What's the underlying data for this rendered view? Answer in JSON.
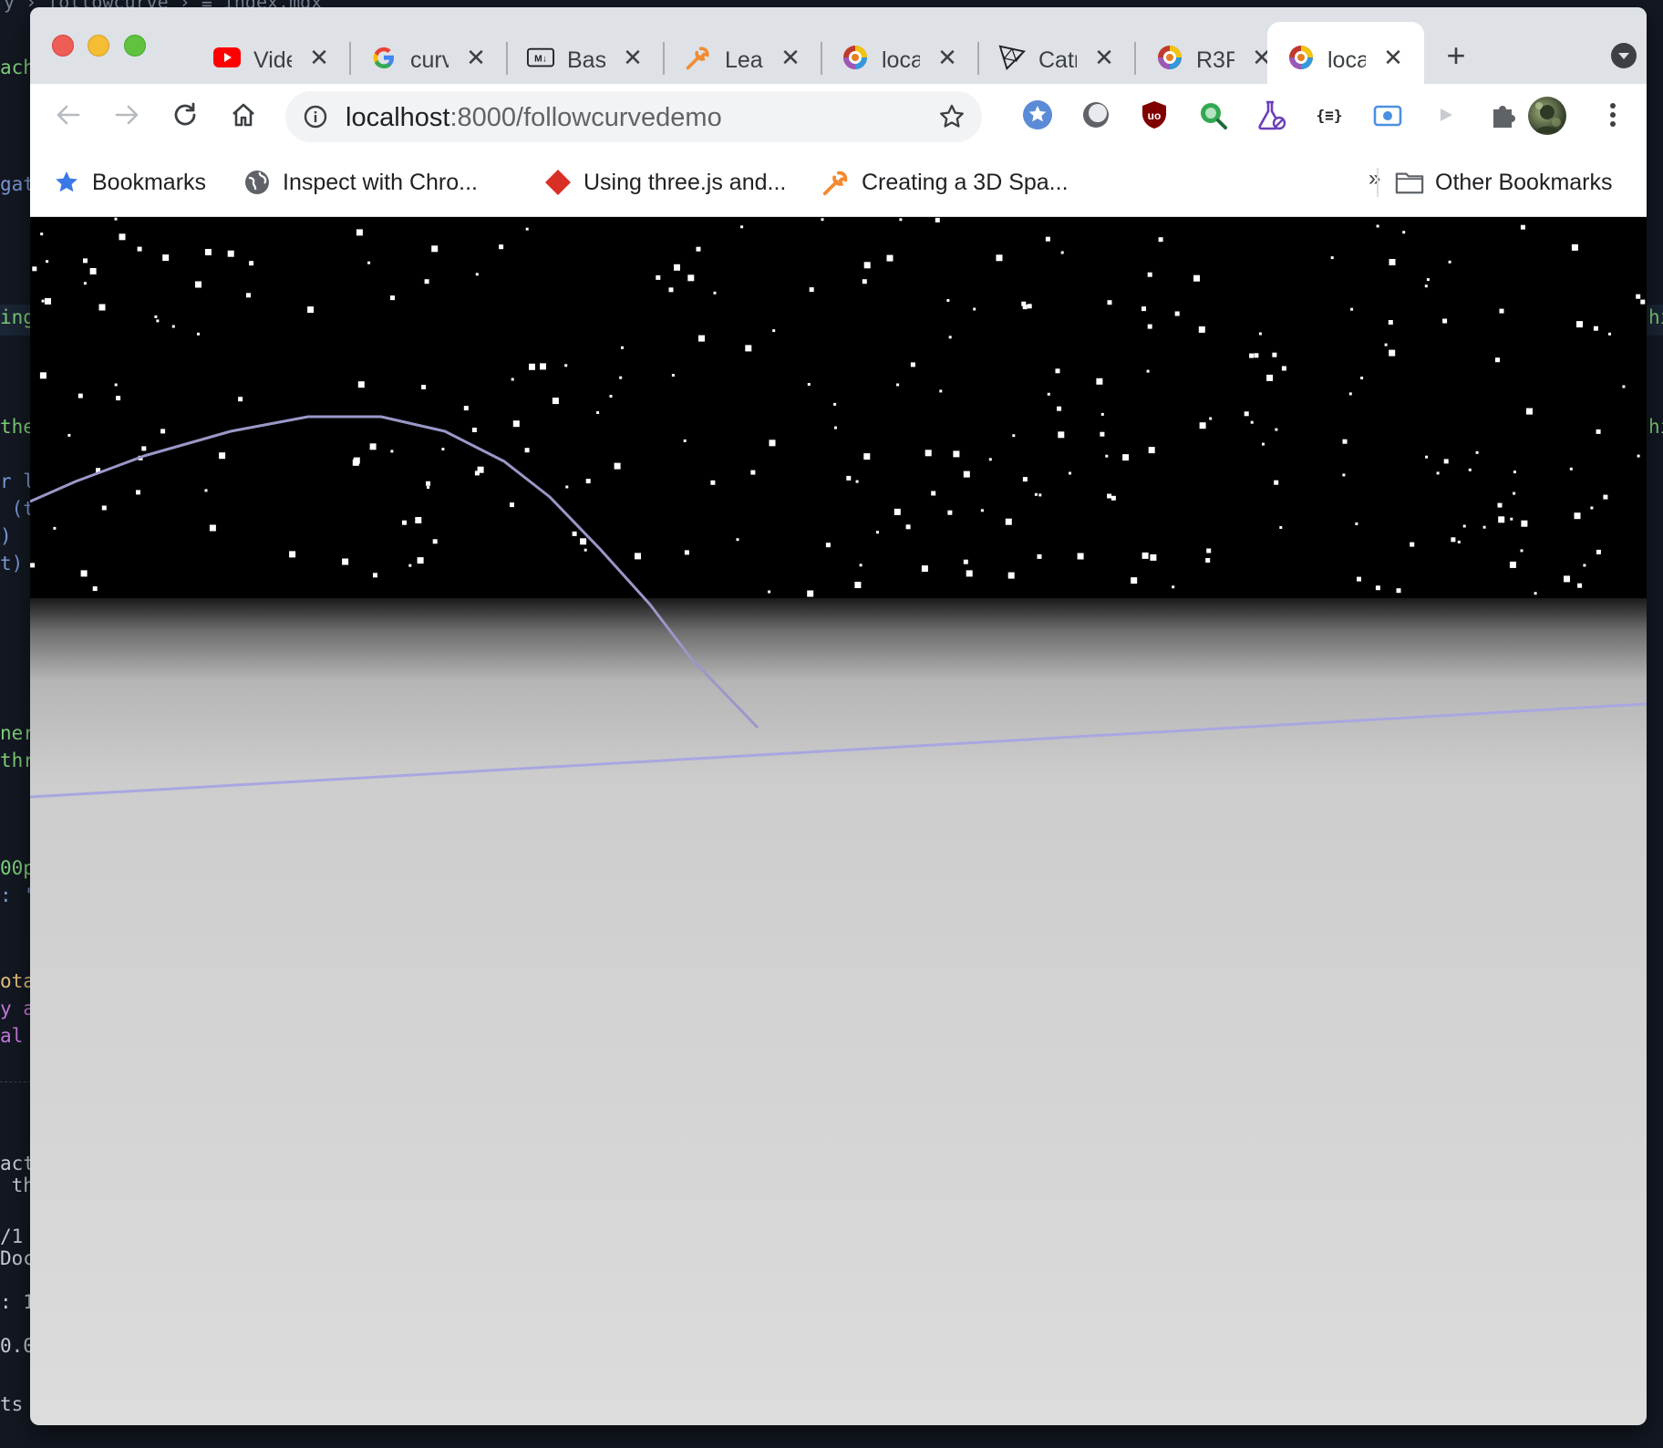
{
  "editor": {
    "breadcrumb": "y › followcurve › ≡ index.mdx",
    "fragments_left": [
      {
        "text": "ach",
        "color": "#7fd07a"
      },
      {
        "text": "gat",
        "color": "#7a9ad6"
      },
      {
        "text": "ing",
        "color": "#7fd07a"
      },
      {
        "text": "the",
        "color": "#7fd07a"
      },
      {
        "text": "r l",
        "color": "#7a9ad6"
      },
      {
        "text": " (t",
        "color": "#7a9ad6"
      },
      {
        "text": ")",
        "color": "#7a9ad6"
      },
      {
        "text": "t)",
        "color": "#7a9ad6"
      },
      {
        "text": "ner",
        "color": "#7fd07a"
      },
      {
        "text": "thr",
        "color": "#7fd07a"
      },
      {
        "text": "00p",
        "color": "#7fd07a"
      },
      {
        "text": ": '",
        "color": "#7a9ad6"
      },
      {
        "text": "ota",
        "color": "#e6c07b"
      },
      {
        "text": "y a",
        "color": "#c678dd"
      },
      {
        "text": "al ",
        "color": "#c678dd"
      },
      {
        "text": "act",
        "color": "#c9cfd8"
      },
      {
        "text": " th",
        "color": "#c9cfd8"
      },
      {
        "text": "/1",
        "color": "#c9cfd8"
      },
      {
        "text": "Doc",
        "color": "#c9cfd8"
      },
      {
        "text": ": 1",
        "color": "#c9cfd8"
      },
      {
        "text": "0.0",
        "color": "#c9cfd8"
      },
      {
        "text": "ts",
        "color": "#c9cfd8"
      }
    ],
    "fragments_right": [
      "hi",
      "hi"
    ]
  },
  "browser": {
    "tabs": [
      {
        "title": "Video",
        "icon": "youtube-icon",
        "active": false
      },
      {
        "title": "curve",
        "icon": "google-icon",
        "active": false
      },
      {
        "title": "Basic",
        "icon": "markdown-icon",
        "active": false
      },
      {
        "title": "Learn",
        "icon": "wrench-icon",
        "active": false
      },
      {
        "title": "local",
        "icon": "color-wheel-icon",
        "active": false
      },
      {
        "title": "Catmull",
        "icon": "threejs-icon",
        "active": false
      },
      {
        "title": "R3F",
        "icon": "color-wheel-icon",
        "active": false
      },
      {
        "title": "local",
        "icon": "color-wheel-icon",
        "active": true
      }
    ],
    "new_tab_label": "+",
    "close_glyph": "✕",
    "url_host": "localhost",
    "url_path": ":8000/followcurvedemo",
    "extensions": [
      "bookmark-star-extension-icon",
      "circle-extension-icon",
      "ublock-icon",
      "search-extension-icon",
      "flask-icon",
      "json-formatter-icon",
      "screen-capture-icon",
      "play-extension-icon",
      "puzzle-icon"
    ],
    "bookmarks": [
      {
        "label": "Bookmarks",
        "icon": "star-icon"
      },
      {
        "label": "Inspect with Chro...",
        "icon": "globe-icon"
      },
      {
        "label": "Using three.js and...",
        "icon": "diamond-icon"
      },
      {
        "label": "Creating a 3D Spa...",
        "icon": "wrench-icon"
      }
    ],
    "bookmarks_overflow": "»",
    "other_bookmarks": "Other Bookmarks"
  },
  "scene": {
    "sky_color": "#000000",
    "ground_top_color": "#1a1a1a",
    "ground_bottom_color": "#dcdcdc",
    "curve_color": "#9a98c8",
    "star_color": "#ffffff"
  }
}
